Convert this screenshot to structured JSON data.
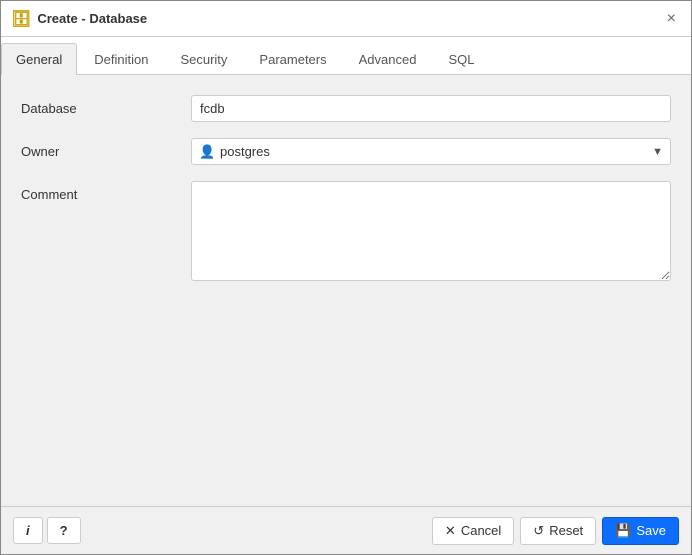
{
  "dialog": {
    "title": "Create - Database",
    "title_icon": "🗄",
    "close_label": "×"
  },
  "tabs": [
    {
      "id": "general",
      "label": "General",
      "active": true
    },
    {
      "id": "definition",
      "label": "Definition",
      "active": false
    },
    {
      "id": "security",
      "label": "Security",
      "active": false
    },
    {
      "id": "parameters",
      "label": "Parameters",
      "active": false
    },
    {
      "id": "advanced",
      "label": "Advanced",
      "active": false
    },
    {
      "id": "sql",
      "label": "SQL",
      "active": false
    }
  ],
  "form": {
    "database_label": "Database",
    "database_value": "fcdb",
    "database_placeholder": "",
    "owner_label": "Owner",
    "owner_value": "postgres",
    "comment_label": "Comment",
    "comment_value": ""
  },
  "footer": {
    "info_label": "i",
    "help_label": "?",
    "cancel_label": "Cancel",
    "cancel_icon": "✕",
    "reset_label": "Reset",
    "reset_icon": "↺",
    "save_label": "Save",
    "save_icon": "💾"
  }
}
